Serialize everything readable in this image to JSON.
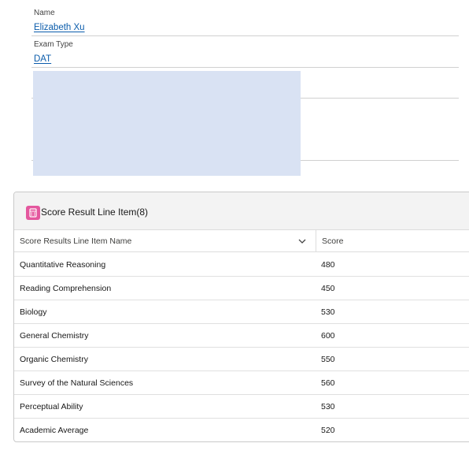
{
  "record": {
    "name_label": "Name",
    "name_value": "Elizabeth Xu",
    "exam_type_label": "Exam Type",
    "exam_type_value": "DAT"
  },
  "related_list": {
    "title": "Score Result Line Item(8)",
    "icon": "score-report-icon",
    "icon_color": "#e4579e",
    "columns": {
      "name": "Score Results Line Item Name",
      "score": "Score"
    },
    "rows": [
      {
        "name": "Quantitative Reasoning",
        "score": "480"
      },
      {
        "name": "Reading Comprehension",
        "score": "450"
      },
      {
        "name": "Biology",
        "score": "530"
      },
      {
        "name": "General Chemistry",
        "score": "600"
      },
      {
        "name": "Organic Chemistry",
        "score": "550"
      },
      {
        "name": "Survey of the Natural Sciences",
        "score": "560"
      },
      {
        "name": "Perceptual Ability",
        "score": "530"
      },
      {
        "name": "Academic Average",
        "score": "520"
      }
    ]
  }
}
